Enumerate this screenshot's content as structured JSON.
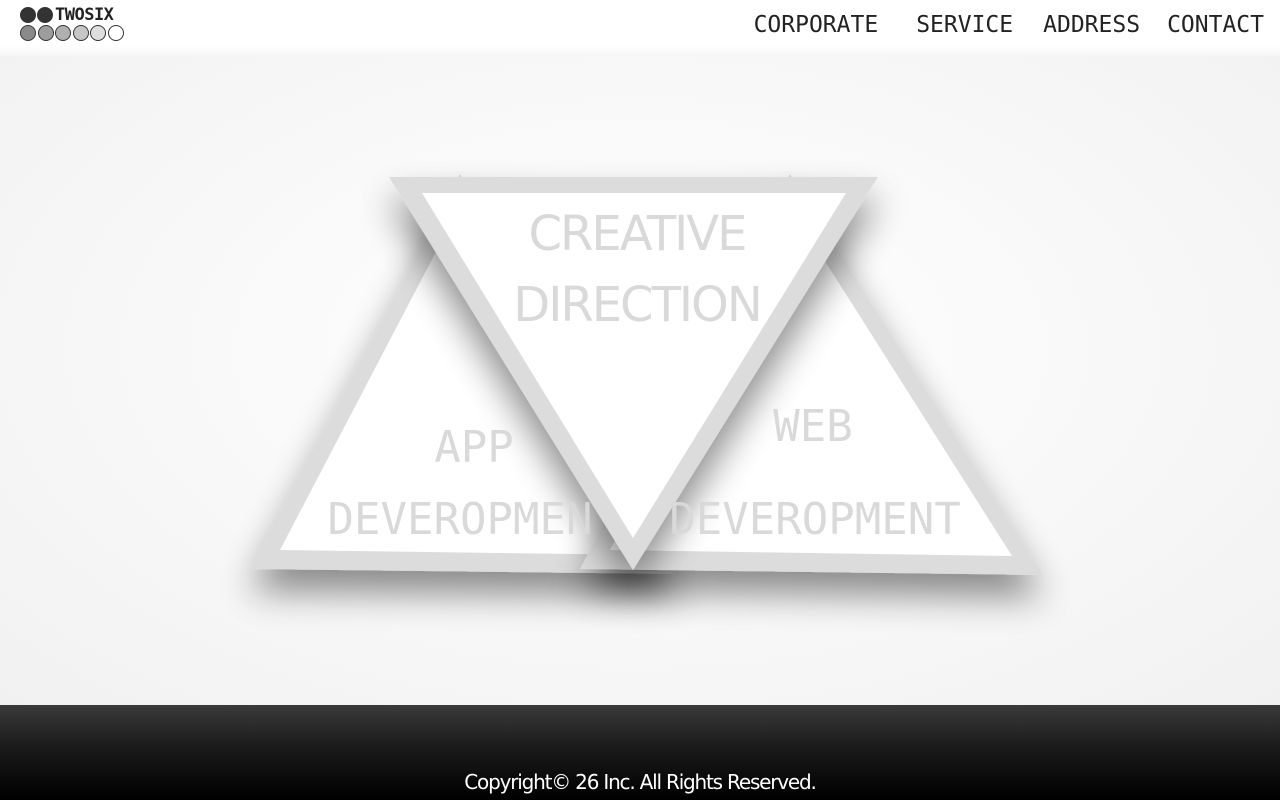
{
  "brand": {
    "name": "TWOSIX"
  },
  "nav": {
    "items": [
      {
        "label": "CORPORATE"
      },
      {
        "label": "SERVICE"
      },
      {
        "label": "ADDRESS"
      },
      {
        "label": "CONTACT"
      }
    ]
  },
  "main": {
    "triangles": [
      {
        "line1": "APP",
        "line2": "DEVEROPMEN"
      },
      {
        "line1": "CREATIVE",
        "line2": "DIRECTION"
      },
      {
        "line1": "WEB",
        "line2": "DEVEROPMENT"
      }
    ]
  },
  "footer": {
    "copyright": "Copyright© 26 Inc. All Rights Reserved."
  },
  "colors": {
    "triangle_border": "#dcdcdc",
    "triangle_fill": "#ffffff",
    "label_text": "#d9d9d9",
    "footer_bg": "#000000",
    "footer_text": "#ffffff"
  }
}
